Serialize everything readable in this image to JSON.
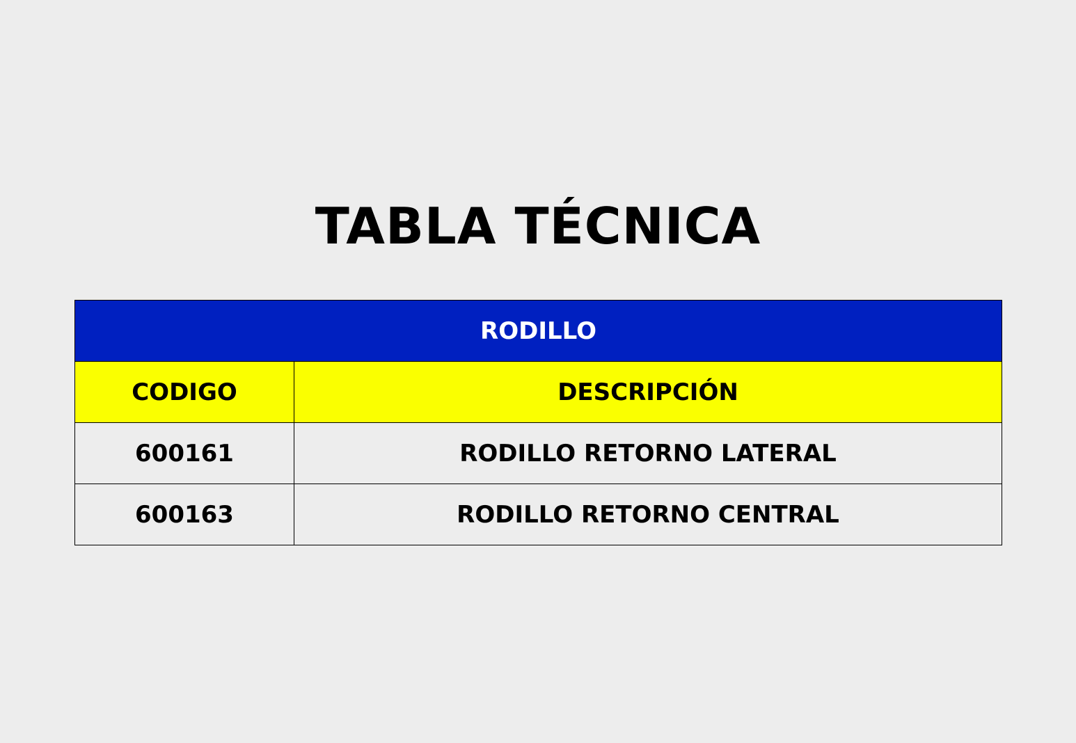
{
  "page": {
    "title": "TABLA TÉCNICA"
  },
  "table": {
    "caption": "RODILLO",
    "headers": {
      "code": "CODIGO",
      "description": "DESCRIPCIÓN"
    },
    "rows": [
      {
        "code": "600161",
        "description": "RODILLO RETORNO LATERAL"
      },
      {
        "code": "600163",
        "description": "RODILLO RETORNO CENTRAL"
      }
    ]
  },
  "colors": {
    "background": "#EDEDED",
    "caption_bg": "#0020C0",
    "caption_text": "#FFFFFF",
    "header_bg": "#FAFF00",
    "text": "#000000"
  }
}
